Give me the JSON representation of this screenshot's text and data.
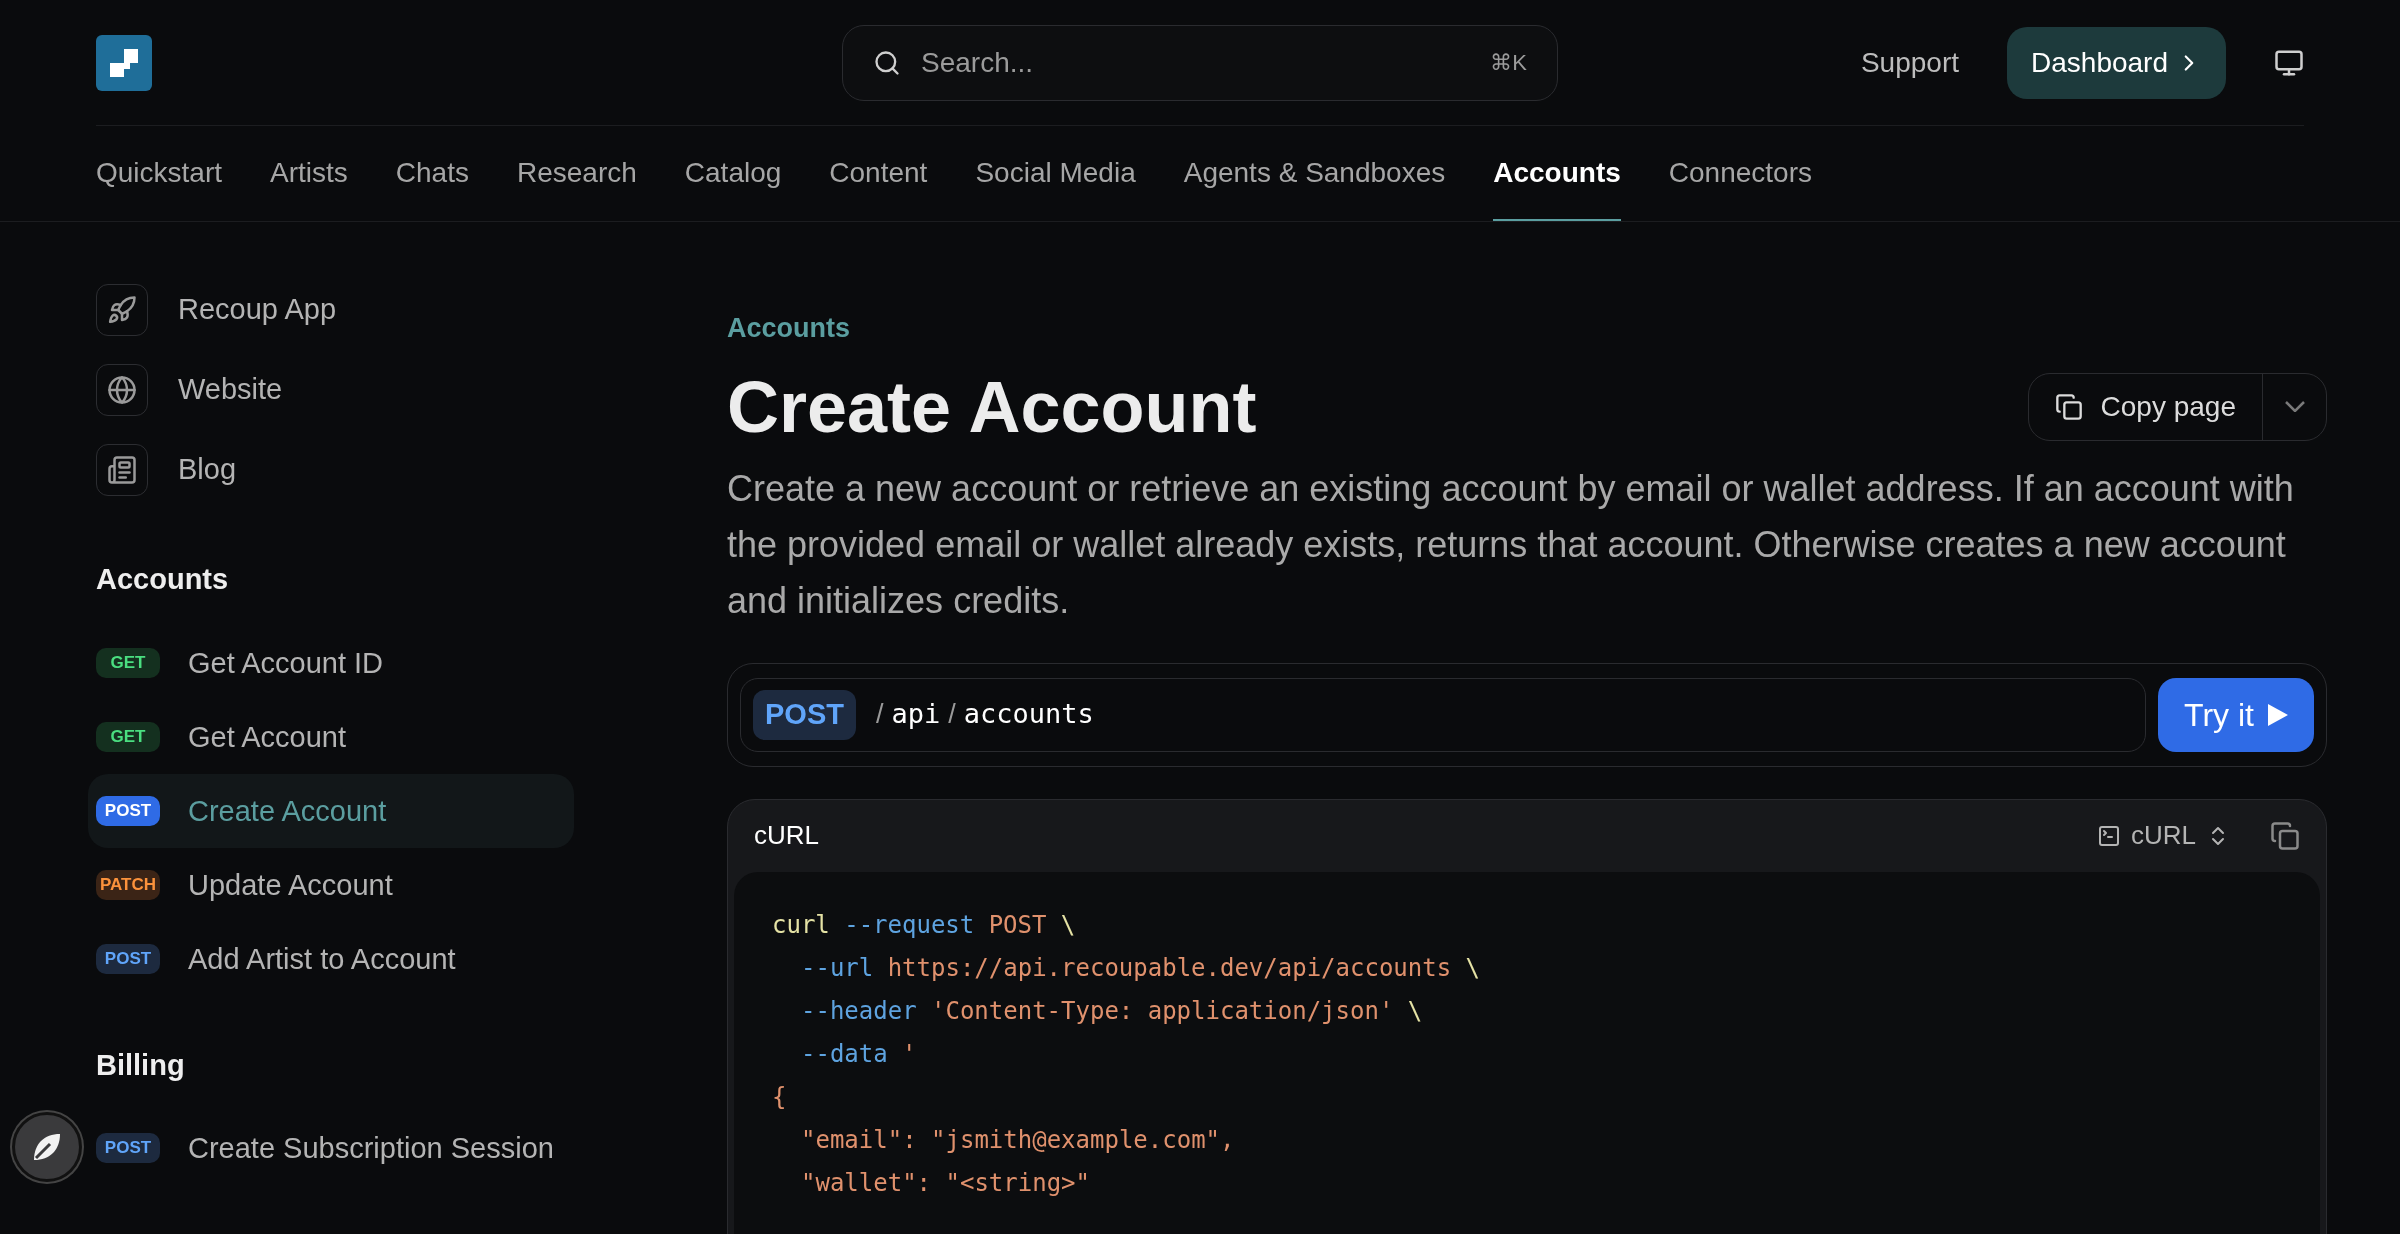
{
  "header": {
    "search": {
      "placeholder": "Search...",
      "shortcut": "⌘K"
    },
    "support": "Support",
    "dashboard": "Dashboard"
  },
  "tabs": [
    {
      "label": "Quickstart",
      "selected": false
    },
    {
      "label": "Artists",
      "selected": false
    },
    {
      "label": "Chats",
      "selected": false
    },
    {
      "label": "Research",
      "selected": false
    },
    {
      "label": "Catalog",
      "selected": false
    },
    {
      "label": "Content",
      "selected": false
    },
    {
      "label": "Social Media",
      "selected": false
    },
    {
      "label": "Agents & Sandboxes",
      "selected": false
    },
    {
      "label": "Accounts",
      "selected": true
    },
    {
      "label": "Connectors",
      "selected": false
    }
  ],
  "sidebar": {
    "links": [
      {
        "label": "Recoup App",
        "kind": "rocket"
      },
      {
        "label": "Website",
        "kind": "globe"
      },
      {
        "label": "Blog",
        "kind": "news"
      }
    ],
    "groups": [
      {
        "title": "Accounts",
        "items": [
          {
            "method": "GET",
            "kind": "get",
            "label": "Get Account ID",
            "selected": false
          },
          {
            "method": "GET",
            "kind": "get",
            "label": "Get Account",
            "selected": false
          },
          {
            "method": "POST",
            "kind": "post",
            "label": "Create Account",
            "selected": true
          },
          {
            "method": "PATCH",
            "kind": "patch",
            "label": "Update Account",
            "selected": false
          },
          {
            "method": "POST",
            "kind": "post",
            "label": "Add Artist to Account",
            "selected": false
          }
        ]
      },
      {
        "title": "Billing",
        "items": [
          {
            "method": "POST",
            "kind": "post",
            "label": "Create Subscription Session",
            "selected": false
          }
        ]
      }
    ]
  },
  "page": {
    "breadcrumb": "Accounts",
    "title": "Create Account",
    "copy_button": "Copy page",
    "description": "Create a new account or retrieve an existing account by email or wallet address. If an account with the provided email or wallet already exists, returns that account. Otherwise creates a new account and initializes credits.",
    "endpoint": {
      "method": "POST",
      "path_separator": "/",
      "path": [
        "api",
        "accounts"
      ],
      "try_button": "Try it"
    },
    "code": {
      "title": "cURL",
      "language": "cURL",
      "lines": [
        {
          "indented": false,
          "tokens": [
            {
              "kind": "command",
              "text": "curl"
            },
            {
              "kind": "flag",
              "text": "--request"
            },
            {
              "kind": "string",
              "text": "POST"
            },
            {
              "kind": "punct",
              "text": "\\"
            }
          ]
        },
        {
          "indented": true,
          "tokens": [
            {
              "kind": "flag",
              "text": "--url"
            },
            {
              "kind": "string",
              "text": "https://api.recoupable.dev/api/accounts"
            },
            {
              "kind": "punct",
              "text": "\\"
            }
          ]
        },
        {
          "indented": true,
          "tokens": [
            {
              "kind": "flag",
              "text": "--header"
            },
            {
              "kind": "string",
              "text": "'Content-Type: application/json'"
            },
            {
              "kind": "punct",
              "text": "\\"
            }
          ]
        },
        {
          "indented": true,
          "tokens": [
            {
              "kind": "flag",
              "text": "--data"
            },
            {
              "kind": "string",
              "text": "'"
            }
          ]
        },
        {
          "indented": false,
          "tokens": [
            {
              "kind": "string",
              "text": "{"
            }
          ]
        },
        {
          "indented": true,
          "tokens": [
            {
              "kind": "string",
              "text": "\"email\": \"jsmith@example.com\","
            }
          ]
        },
        {
          "indented": true,
          "tokens": [
            {
              "kind": "string",
              "text": "\"wallet\": \"<string>\""
            }
          ]
        }
      ]
    }
  }
}
